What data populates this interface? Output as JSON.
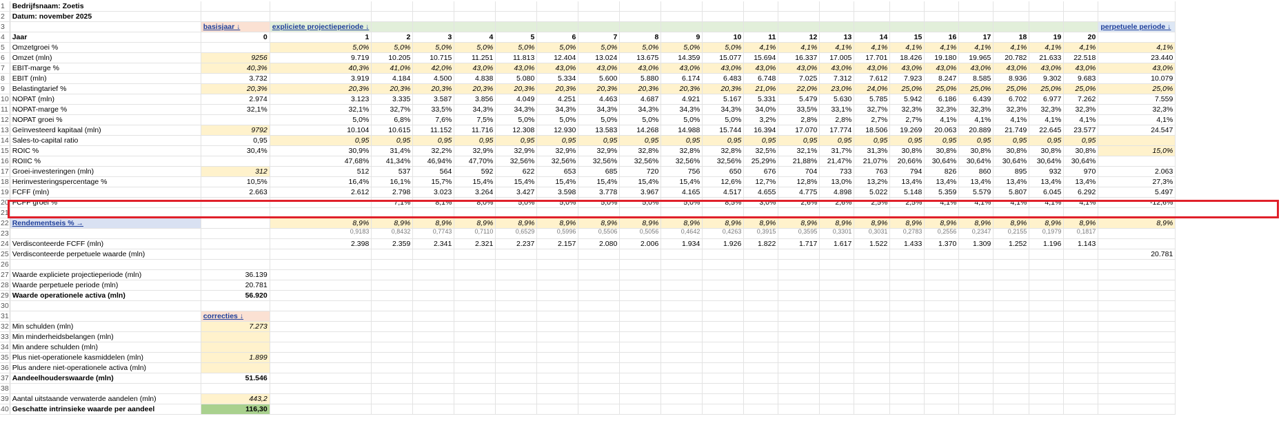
{
  "company": "Bedrijfsnaam: Zoetis",
  "date": "Datum: november 2025",
  "headers": {
    "basis": "basisjaar ↓",
    "explicit": "expliciete projectieperiode ↓",
    "perpetual": "perpetuele periode ↓",
    "corrections": "correcties ↓"
  },
  "years_label": "Jaar",
  "years": [
    "0",
    "1",
    "2",
    "3",
    "4",
    "5",
    "6",
    "7",
    "8",
    "9",
    "10",
    "11",
    "12",
    "13",
    "14",
    "15",
    "16",
    "17",
    "18",
    "19",
    "20"
  ],
  "rows": [
    {
      "r": "5",
      "label": "Omzetgroei %",
      "b": "",
      "v": [
        "5,0%",
        "5,0%",
        "5,0%",
        "5,0%",
        "5,0%",
        "5,0%",
        "5,0%",
        "5,0%",
        "5,0%",
        "5,0%",
        "4,1%",
        "4,1%",
        "4,1%",
        "4,1%",
        "4,1%",
        "4,1%",
        "4,1%",
        "4,1%",
        "4,1%",
        "4,1%"
      ],
      "p": "4,1%",
      "style": "inp"
    },
    {
      "r": "6",
      "label": "Omzet (mln)",
      "b": "9256",
      "v": [
        "9.719",
        "10.205",
        "10.715",
        "11.251",
        "11.813",
        "12.404",
        "13.024",
        "13.675",
        "14.359",
        "15.077",
        "15.694",
        "16.337",
        "17.005",
        "17.701",
        "18.426",
        "19.180",
        "19.965",
        "20.782",
        "21.633",
        "22.518"
      ],
      "p": "23.440",
      "style": "plain",
      "binp": true
    },
    {
      "r": "7",
      "label": "EBIT-marge %",
      "b": "40,3%",
      "v": [
        "40,3%",
        "41,0%",
        "42,0%",
        "43,0%",
        "43,0%",
        "43,0%",
        "43,0%",
        "43,0%",
        "43,0%",
        "43,0%",
        "43,0%",
        "43,0%",
        "43,0%",
        "43,0%",
        "43,0%",
        "43,0%",
        "43,0%",
        "43,0%",
        "43,0%",
        "43,0%"
      ],
      "p": "43,0%",
      "style": "inp",
      "binp": true
    },
    {
      "r": "8",
      "label": "EBIT (mln)",
      "b": "3.732",
      "v": [
        "3.919",
        "4.184",
        "4.500",
        "4.838",
        "5.080",
        "5.334",
        "5.600",
        "5.880",
        "6.174",
        "6.483",
        "6.748",
        "7.025",
        "7.312",
        "7.612",
        "7.923",
        "8.247",
        "8.585",
        "8.936",
        "9.302",
        "9.683"
      ],
      "p": "10.079",
      "style": "plain"
    },
    {
      "r": "9",
      "label": "Belastingtarief %",
      "b": "20,3%",
      "v": [
        "20,3%",
        "20,3%",
        "20,3%",
        "20,3%",
        "20,3%",
        "20,3%",
        "20,3%",
        "20,3%",
        "20,3%",
        "20,3%",
        "21,0%",
        "22,0%",
        "23,0%",
        "24,0%",
        "25,0%",
        "25,0%",
        "25,0%",
        "25,0%",
        "25,0%",
        "25,0%"
      ],
      "p": "25,0%",
      "style": "inp",
      "binp": true
    },
    {
      "r": "10",
      "label": "NOPAT (mln)",
      "b": "2.974",
      "v": [
        "3.123",
        "3.335",
        "3.587",
        "3.856",
        "4.049",
        "4.251",
        "4.463",
        "4.687",
        "4.921",
        "5.167",
        "5.331",
        "5.479",
        "5.630",
        "5.785",
        "5.942",
        "6.186",
        "6.439",
        "6.702",
        "6.977",
        "7.262"
      ],
      "p": "7.559",
      "style": "plain"
    },
    {
      "r": "11",
      "label": "NOPAT-marge %",
      "b": "32,1%",
      "v": [
        "32,1%",
        "32,7%",
        "33,5%",
        "34,3%",
        "34,3%",
        "34,3%",
        "34,3%",
        "34,3%",
        "34,3%",
        "34,3%",
        "34,0%",
        "33,5%",
        "33,1%",
        "32,7%",
        "32,3%",
        "32,3%",
        "32,3%",
        "32,3%",
        "32,3%",
        "32,3%"
      ],
      "p": "32,3%",
      "style": "plain"
    },
    {
      "r": "12",
      "label": "NOPAT groei %",
      "b": "",
      "v": [
        "5,0%",
        "6,8%",
        "7,6%",
        "7,5%",
        "5,0%",
        "5,0%",
        "5,0%",
        "5,0%",
        "5,0%",
        "5,0%",
        "3,2%",
        "2,8%",
        "2,8%",
        "2,7%",
        "2,7%",
        "4,1%",
        "4,1%",
        "4,1%",
        "4,1%",
        "4,1%"
      ],
      "p": "4,1%",
      "style": "plain"
    },
    {
      "r": "13",
      "label": "Geïnvesteerd kapitaal (mln)",
      "b": "9792",
      "v": [
        "10.104",
        "10.615",
        "11.152",
        "11.716",
        "12.308",
        "12.930",
        "13.583",
        "14.268",
        "14.988",
        "15.744",
        "16.394",
        "17.070",
        "17.774",
        "18.506",
        "19.269",
        "20.063",
        "20.889",
        "21.749",
        "22.645",
        "23.577"
      ],
      "p": "24.547",
      "style": "plain",
      "binp": true
    },
    {
      "r": "14",
      "label": "Sales-to-capital ratio",
      "b": "0,95",
      "v": [
        "0,95",
        "0,95",
        "0,95",
        "0,95",
        "0,95",
        "0,95",
        "0,95",
        "0,95",
        "0,95",
        "0,95",
        "0,95",
        "0,95",
        "0,95",
        "0,95",
        "0,95",
        "0,95",
        "0,95",
        "0,95",
        "0,95",
        "0,95"
      ],
      "p": "",
      "style": "inp"
    },
    {
      "r": "15",
      "label": "ROIC %",
      "b": "30,4%",
      "v": [
        "30,9%",
        "31,4%",
        "32,2%",
        "32,9%",
        "32,9%",
        "32,9%",
        "32,9%",
        "32,8%",
        "32,8%",
        "32,8%",
        "32,5%",
        "32,1%",
        "31,7%",
        "31,3%",
        "30,8%",
        "30,8%",
        "30,8%",
        "30,8%",
        "30,8%",
        "30,8%"
      ],
      "p": "15,0%",
      "style": "plain",
      "pinp": true
    },
    {
      "r": "16",
      "label": "ROIIC %",
      "b": "",
      "v": [
        "47,68%",
        "41,34%",
        "46,94%",
        "47,70%",
        "32,56%",
        "32,56%",
        "32,56%",
        "32,56%",
        "32,56%",
        "32,56%",
        "25,29%",
        "21,88%",
        "21,47%",
        "21,07%",
        "20,66%",
        "30,64%",
        "30,64%",
        "30,64%",
        "30,64%",
        "30,64%"
      ],
      "p": "",
      "style": "plain"
    },
    {
      "r": "17",
      "label": "Groei-investeringen (mln)",
      "b": "312",
      "v": [
        "512",
        "537",
        "564",
        "592",
        "622",
        "653",
        "685",
        "720",
        "756",
        "650",
        "676",
        "704",
        "733",
        "763",
        "794",
        "826",
        "860",
        "895",
        "932",
        "970"
      ],
      "p": "2.063",
      "style": "plain",
      "binp": true
    },
    {
      "r": "18",
      "label": "Herinvesteringspercentage %",
      "b": "10,5%",
      "v": [
        "16,4%",
        "16,1%",
        "15,7%",
        "15,4%",
        "15,4%",
        "15,4%",
        "15,4%",
        "15,4%",
        "15,4%",
        "12,6%",
        "12,7%",
        "12,8%",
        "13,0%",
        "13,2%",
        "13,4%",
        "13,4%",
        "13,4%",
        "13,4%",
        "13,4%",
        "13,4%"
      ],
      "p": "27,3%",
      "style": "plain"
    },
    {
      "r": "19",
      "label": "FCFF (mln)",
      "b": "2.663",
      "v": [
        "2.612",
        "2.798",
        "3.023",
        "3.264",
        "3.427",
        "3.598",
        "3.778",
        "3.967",
        "4.165",
        "4.517",
        "4.655",
        "4.775",
        "4.898",
        "5.022",
        "5.148",
        "5.359",
        "5.579",
        "5.807",
        "6.045",
        "6.292"
      ],
      "p": "5.497",
      "style": "plain"
    },
    {
      "r": "20",
      "label": "FCFF groei %",
      "b": "",
      "v": [
        "",
        "7,1%",
        "8,1%",
        "8,0%",
        "5,0%",
        "5,0%",
        "5,0%",
        "5,0%",
        "5,0%",
        "8,5%",
        "3,0%",
        "2,6%",
        "2,6%",
        "2,5%",
        "2,5%",
        "4,1%",
        "4,1%",
        "4,1%",
        "4,1%",
        "4,1%"
      ],
      "p": "-12,6%",
      "style": "plain"
    }
  ],
  "rendement": {
    "r": "22",
    "label": "Rendementseis % →",
    "values": [
      "8,9%",
      "8,9%",
      "8,9%",
      "8,9%",
      "8,9%",
      "8,9%",
      "8,9%",
      "8,9%",
      "8,9%",
      "8,9%",
      "8,9%",
      "8,9%",
      "8,9%",
      "8,9%",
      "8,9%",
      "8,9%",
      "8,9%",
      "8,9%",
      "8,9%",
      "8,9%"
    ],
    "perp": "8,9%"
  },
  "row23_clipped": [
    "0,9183",
    "0,8432",
    "0,7743",
    "0,7110",
    "0,6529",
    "0,5996",
    "0,5506",
    "0,5056",
    "0,4642",
    "0,4263",
    "0,3915",
    "0,3595",
    "0,3301",
    "0,3031",
    "0,2783",
    "0,2556",
    "0,2347",
    "0,2155",
    "0,1979",
    "0,1817"
  ],
  "row24": {
    "r": "24",
    "label": "Verdisconteerde FCFF (mln)",
    "v": [
      "2.398",
      "2.359",
      "2.341",
      "2.321",
      "2.237",
      "2.157",
      "2.080",
      "2.006",
      "1.934",
      "1.926",
      "1.822",
      "1.717",
      "1.617",
      "1.522",
      "1.433",
      "1.370",
      "1.309",
      "1.252",
      "1.196",
      "1.143"
    ]
  },
  "row25": {
    "r": "25",
    "label": "Verdisconteerde perpetuele waarde (mln)",
    "p": "20.781"
  },
  "summary": [
    {
      "r": "27",
      "label": "Waarde expliciete projectieperiode (mln)",
      "b": "36.139",
      "bold": false
    },
    {
      "r": "28",
      "label": "Waarde perpetuele periode (mln)",
      "b": "20.781",
      "bold": false
    },
    {
      "r": "29",
      "label": "Waarde operationele activa (mln)",
      "b": "56.920",
      "bold": true
    }
  ],
  "corrections": [
    {
      "r": "32",
      "label": "Min schulden (mln)",
      "b": "7.273"
    },
    {
      "r": "33",
      "label": "Min minderheidsbelangen (mln)",
      "b": ""
    },
    {
      "r": "34",
      "label": "Min andere schulden (mln)",
      "b": ""
    },
    {
      "r": "35",
      "label": "Plus niet-operationele kasmiddelen (mln)",
      "b": "1.899"
    },
    {
      "r": "36",
      "label": "Plus andere niet-operationele activa (mln)",
      "b": ""
    }
  ],
  "equity": {
    "r": "37",
    "label": "Aandeelhouderswaarde (mln)",
    "b": "51.546"
  },
  "shares": {
    "r": "39",
    "label": "Aantal uitstaande verwaterde aandelen (mln)",
    "b": "443,2"
  },
  "intrinsic": {
    "r": "40",
    "label": "Geschatte intrinsieke waarde per aandeel",
    "b": "116,30"
  }
}
